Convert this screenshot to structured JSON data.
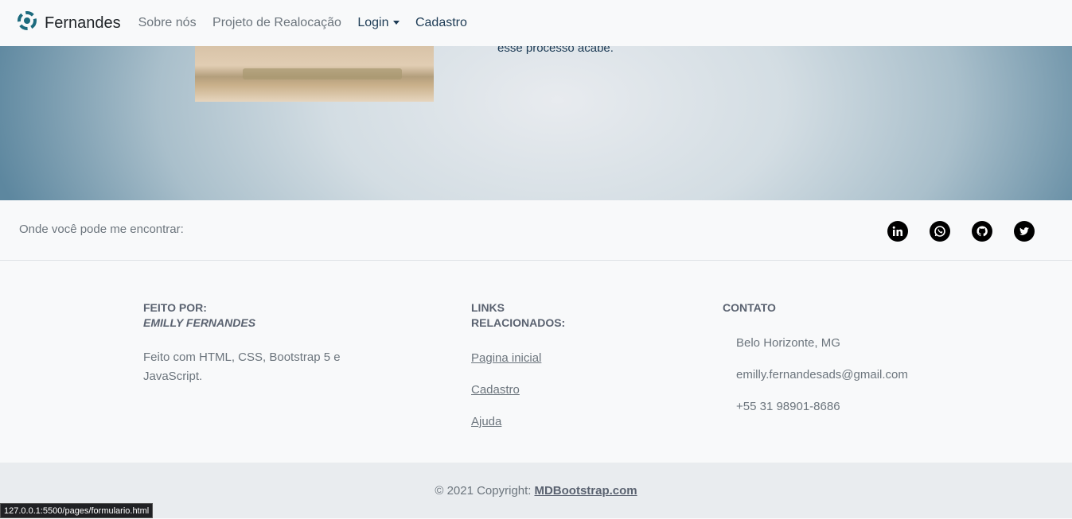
{
  "navbar": {
    "brand": "Fernandes",
    "links": [
      "Sobre nós",
      "Projeto de Realocação",
      "Login",
      "Cadastro"
    ]
  },
  "hero": {
    "text": "esse processo acabe."
  },
  "social": {
    "label": "Onde você pode me encontrar:",
    "icons": [
      "linkedin-icon",
      "whatsapp-icon",
      "github-icon",
      "twitter-icon"
    ]
  },
  "footer": {
    "col1": {
      "heading1": "FEITO POR:",
      "heading2": "EMILLY FERNANDES",
      "text": "Feito com HTML, CSS, Bootstrap 5 e JavaScript."
    },
    "col2": {
      "heading": "LINKS RELACIONADOS:",
      "links": [
        "Pagina inicial",
        "Cadastro",
        "Ajuda"
      ]
    },
    "col3": {
      "heading": "CONTATO",
      "items": [
        "Belo Horizonte, MG",
        "emilly.fernandesads@gmail.com",
        "+55 31 98901-8686"
      ]
    }
  },
  "copyright": {
    "text": "© 2021 Copyright:",
    "link": "MDBootstrap.com"
  },
  "status_bar": "127.0.0.1:5500/pages/formulario.html",
  "colors": {
    "navbar_bg": "#f8f9fa",
    "hero_edge": "#5d879f",
    "footer_bg": "#e9ecef"
  }
}
